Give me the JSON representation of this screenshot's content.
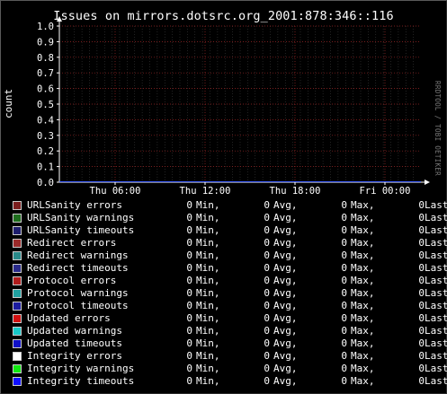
{
  "title": "Issues on mirrors.dotsrc.org_2001:878:346::116",
  "watermark": "RRDTOOL / TOBI OETIKER",
  "chart_data": {
    "type": "line",
    "title": "Issues on mirrors.dotsrc.org_2001:878:346::116",
    "ylabel": "count",
    "xlabel": "",
    "ylim": [
      0.0,
      1.0
    ],
    "yticks": [
      "0.0",
      "0.1",
      "0.2",
      "0.3",
      "0.4",
      "0.5",
      "0.6",
      "0.7",
      "0.8",
      "0.9",
      "1.0"
    ],
    "xticks": [
      "Thu 06:00",
      "Thu 12:00",
      "Thu 18:00",
      "Fri 00:00"
    ],
    "grid": true,
    "series": []
  },
  "legend": {
    "labels": {
      "min": "Min,",
      "avg": "Avg,",
      "max": "Max,",
      "last": "Last"
    },
    "items": [
      {
        "name": "URLSanity errors",
        "color": "#7a1e1e",
        "min": "0",
        "avg": "0",
        "max": "0"
      },
      {
        "name": "URLSanity warnings",
        "color": "#1e6e1e",
        "min": "0",
        "avg": "0",
        "max": "0"
      },
      {
        "name": "URLSanity timeouts",
        "color": "#1e1e6e",
        "min": "0",
        "avg": "0",
        "max": "0"
      },
      {
        "name": "Redirect errors",
        "color": "#9a2a2a",
        "min": "0",
        "avg": "0",
        "max": "0"
      },
      {
        "name": "Redirect warnings",
        "color": "#2a8a8a",
        "min": "0",
        "avg": "0",
        "max": "0"
      },
      {
        "name": "Redirect timeouts",
        "color": "#2a2a8a",
        "min": "0",
        "avg": "0",
        "max": "0"
      },
      {
        "name": "Protocol errors",
        "color": "#b01c1c",
        "min": "0",
        "avg": "0",
        "max": "0"
      },
      {
        "name": "Protocol warnings",
        "color": "#20a0a0",
        "min": "0",
        "avg": "0",
        "max": "0"
      },
      {
        "name": "Protocol timeouts",
        "color": "#1c1ca0",
        "min": "0",
        "avg": "0",
        "max": "0"
      },
      {
        "name": "Updated errors",
        "color": "#d01010",
        "min": "0",
        "avg": "0",
        "max": "0"
      },
      {
        "name": "Updated warnings",
        "color": "#18c8c8",
        "min": "0",
        "avg": "0",
        "max": "0"
      },
      {
        "name": "Updated timeouts",
        "color": "#1010c8",
        "min": "0",
        "avg": "0",
        "max": "0"
      },
      {
        "name": "Integrity errors",
        "color": "#ffffff",
        "min": "0",
        "avg": "0",
        "max": "0"
      },
      {
        "name": "Integrity warnings",
        "color": "#10e810",
        "min": "0",
        "avg": "0",
        "max": "0"
      },
      {
        "name": "Integrity timeouts",
        "color": "#1010ff",
        "min": "0",
        "avg": "0",
        "max": "0"
      }
    ]
  }
}
